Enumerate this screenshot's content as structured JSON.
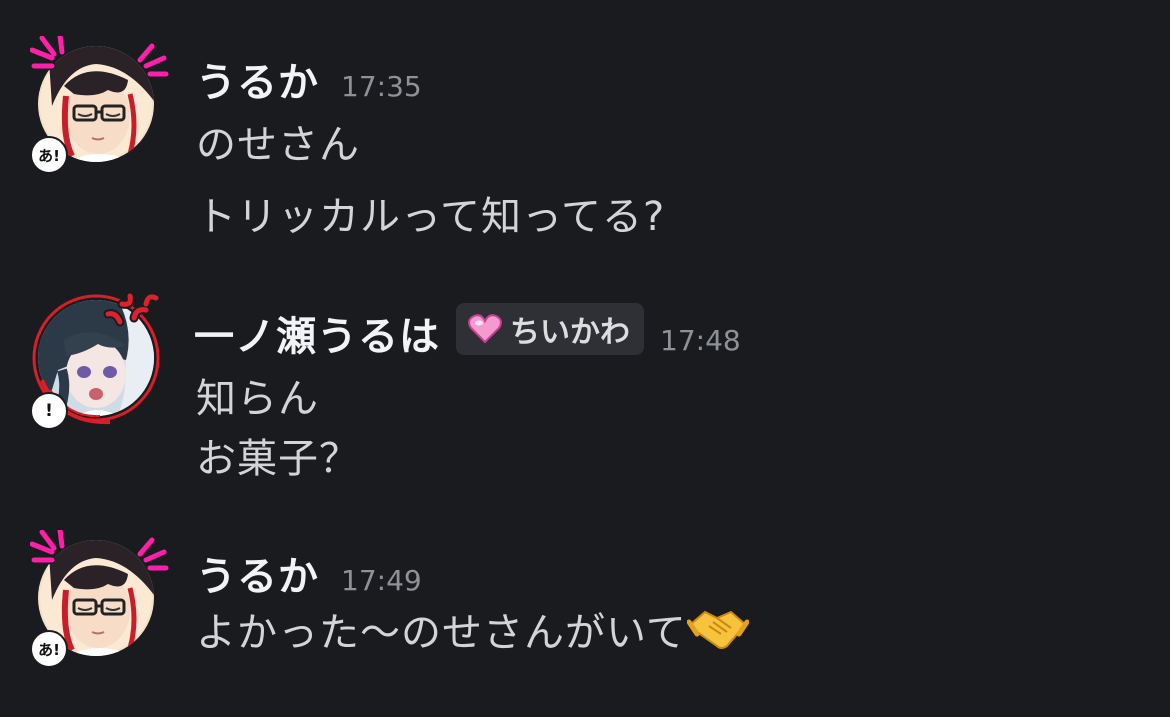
{
  "messages": [
    {
      "username": "うるか",
      "time": "17:35",
      "badge": "あ!",
      "avatar_icon": "avatar-glasses-icon",
      "lines": [
        "のせさん",
        "トリッカルって知ってる?"
      ]
    },
    {
      "username": "一ノ瀬うるは",
      "time": "17:48",
      "badge": "!",
      "avatar_icon": "avatar-angry-girl-icon",
      "role_tag": {
        "label": "ちいかわ",
        "icon": "pink-heart-icon",
        "color": "#f59ad0"
      },
      "lines": [
        "知らん",
        "お菓子？"
      ]
    },
    {
      "username": "うるか",
      "time": "17:49",
      "badge": "あ!",
      "avatar_icon": "avatar-glasses-icon",
      "lines": [
        "よかった〜のせさんがいて"
      ],
      "trailing_emoji": "handshake-emoji"
    }
  ],
  "colors": {
    "background": "#1a1b1f",
    "username": "#f2f3f5",
    "timestamp": "#8e9297",
    "message_text": "#d2d4d8",
    "tag_background": "#2e3036",
    "accent_magenta": "#ff1fa8",
    "accent_red": "#e0202a"
  }
}
